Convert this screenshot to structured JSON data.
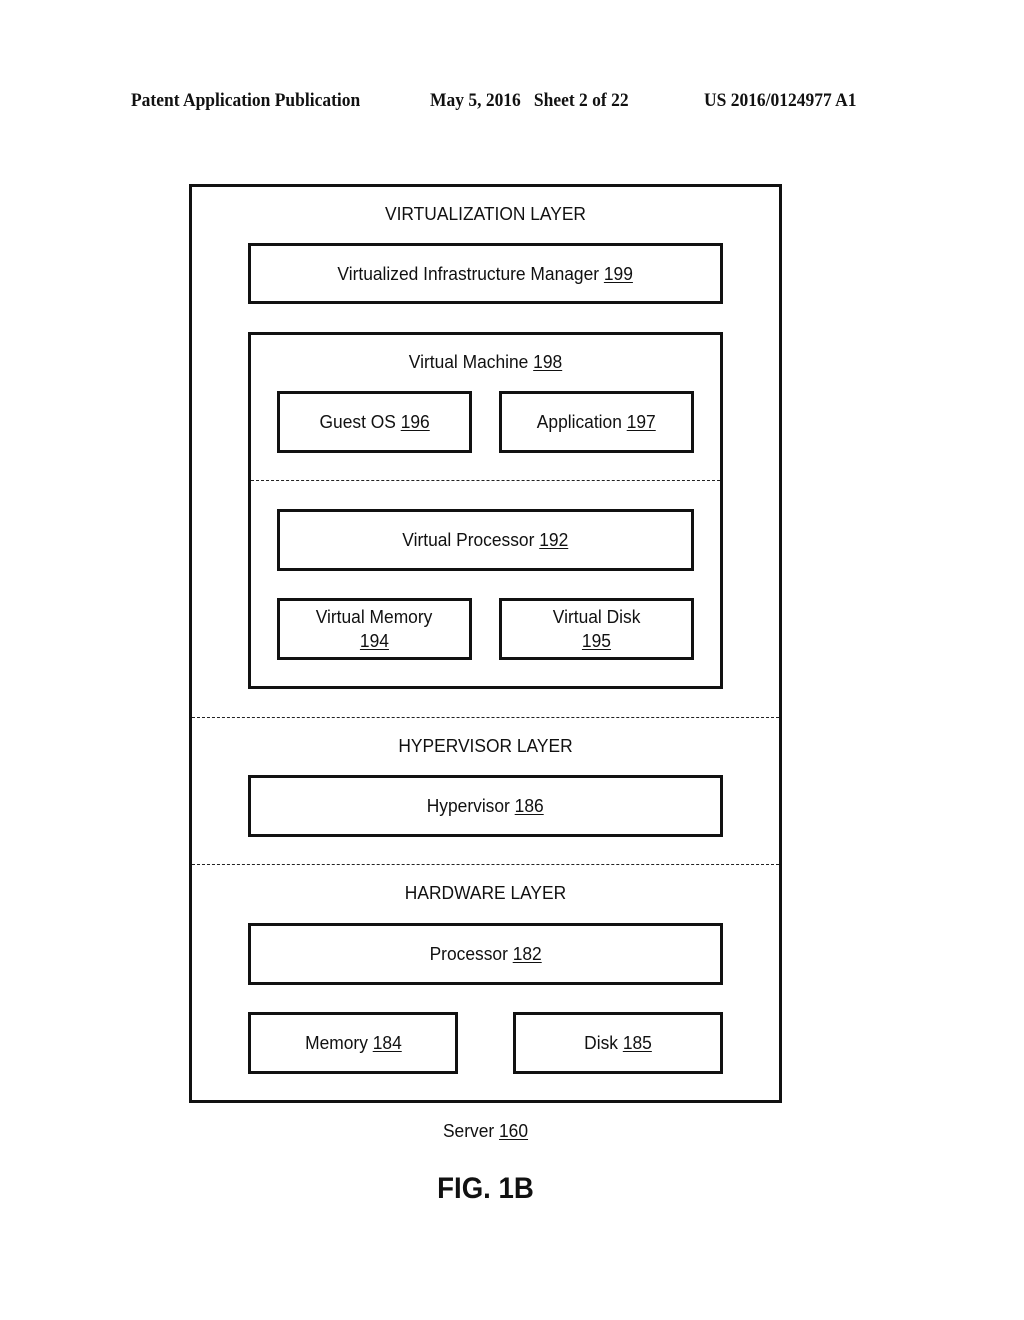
{
  "header": {
    "publication": "Patent Application Publication",
    "date_sheet": "May 5, 2016   Sheet 2 of 22",
    "number": "US 2016/0124977 A1"
  },
  "diagram": {
    "server": {
      "name": "Server",
      "ref": "160"
    },
    "layers": {
      "virtualization": {
        "title": "VIRTUALIZATION LAYER",
        "vim": {
          "name": "Virtualized Infrastructure Manager",
          "ref": "199"
        },
        "vm": {
          "name": "Virtual Machine",
          "ref": "198",
          "guest_os": {
            "name": "Guest OS",
            "ref": "196"
          },
          "application": {
            "name": "Application",
            "ref": "197"
          },
          "vprocessor": {
            "name": "Virtual Processor",
            "ref": "192"
          },
          "vmemory": {
            "name": "Virtual Memory",
            "ref": "194"
          },
          "vdisk": {
            "name": "Virtual Disk",
            "ref": "195"
          }
        }
      },
      "hypervisor": {
        "title": "HYPERVISOR LAYER",
        "hypervisor": {
          "name": "Hypervisor",
          "ref": "186"
        }
      },
      "hardware": {
        "title": "HARDWARE LAYER",
        "processor": {
          "name": "Processor",
          "ref": "182"
        },
        "memory": {
          "name": "Memory",
          "ref": "184"
        },
        "disk": {
          "name": "Disk",
          "ref": "185"
        }
      }
    }
  },
  "figure_label": "FIG. 1B"
}
